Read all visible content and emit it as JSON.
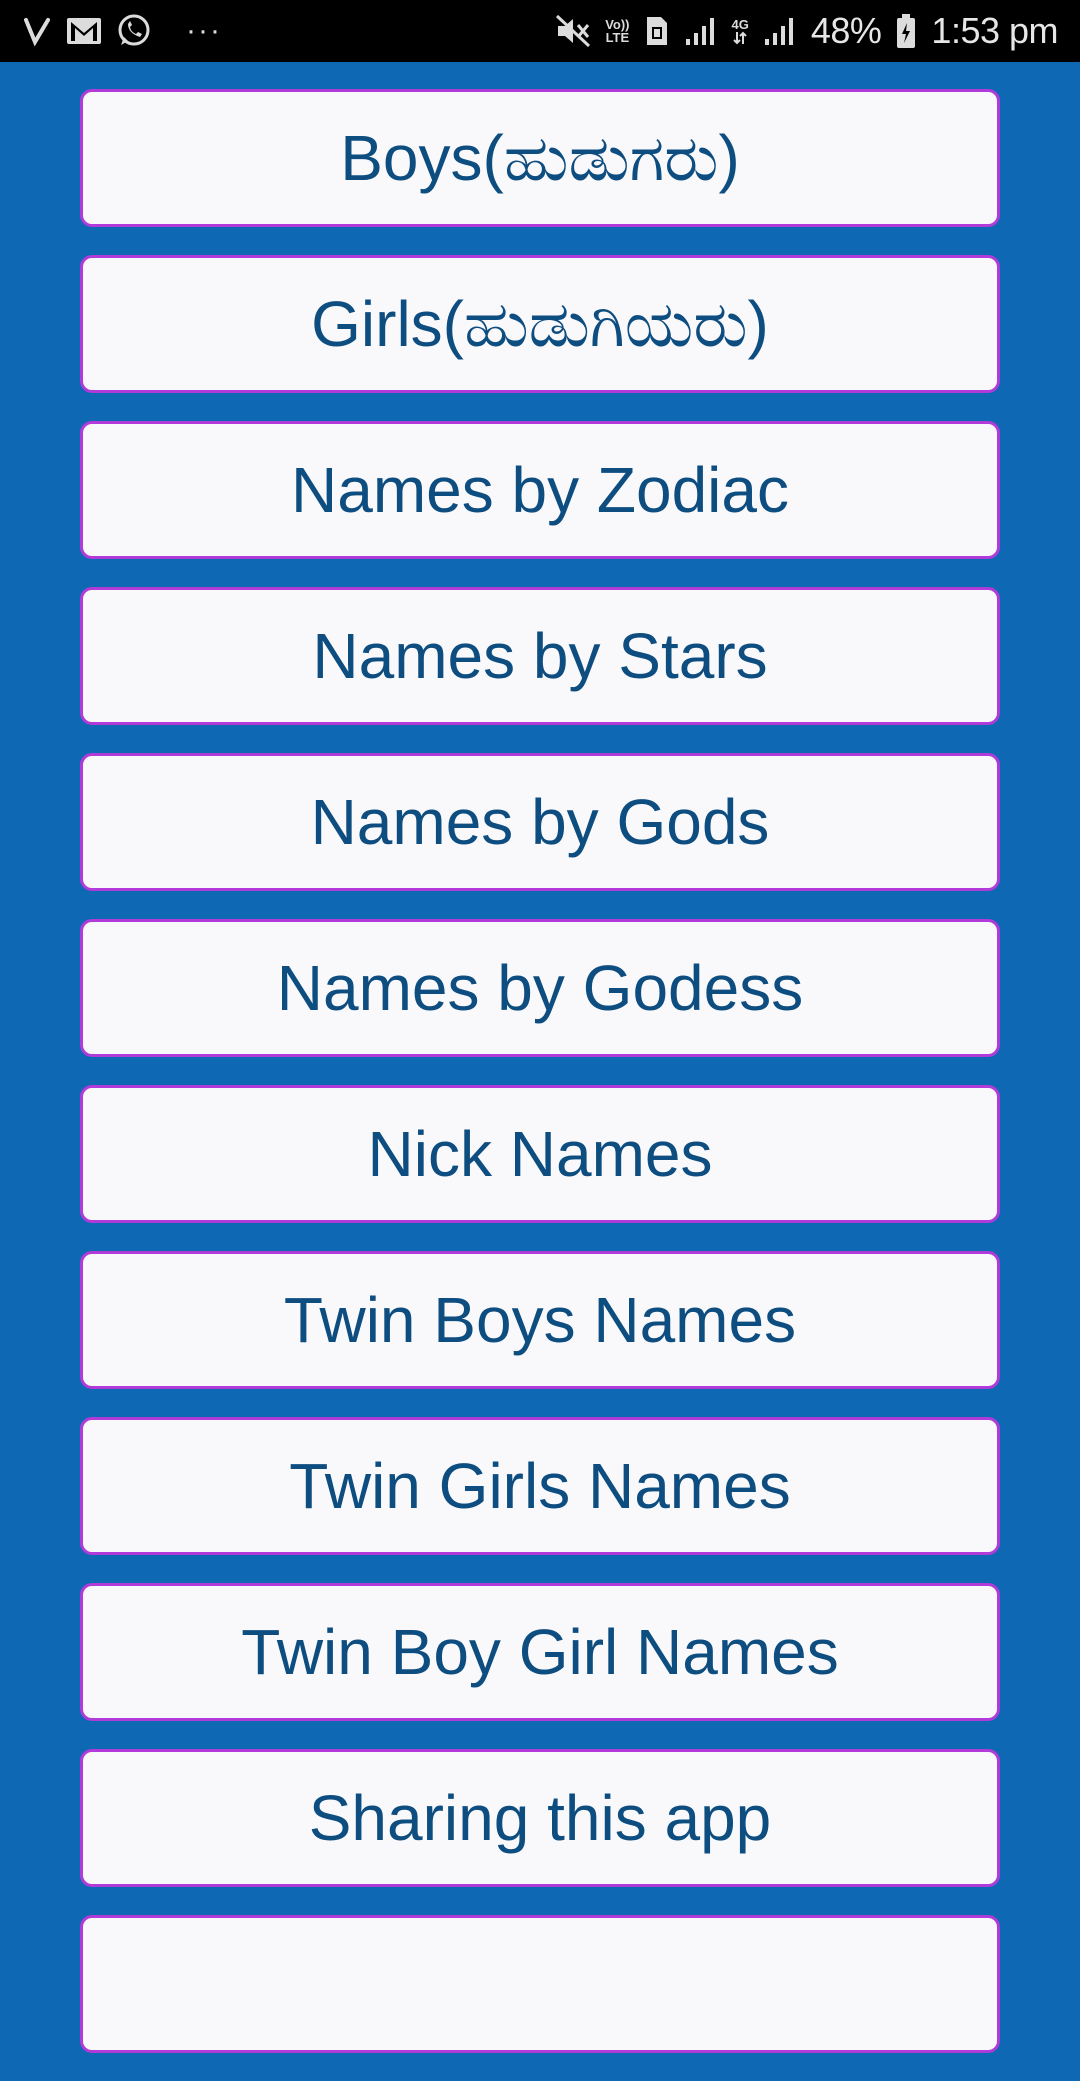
{
  "status_bar": {
    "battery_percent": "48%",
    "time": "1:53 pm",
    "volte_label_top": "Vo))",
    "volte_label_bottom": "LTE",
    "network_label": "4G",
    "left_icons": [
      "signal-check-icon",
      "gmail-icon",
      "whatsapp-icon",
      "more-dots-icon"
    ],
    "right_icons": [
      "mute-icon",
      "volte-icon",
      "sim-icon",
      "signal-bars-icon",
      "4g-icon",
      "signal-bars-icon",
      "battery-icon"
    ],
    "dots": "···"
  },
  "menu": {
    "items": [
      {
        "label": "Boys(ಹುಡುಗರು)"
      },
      {
        "label": "Girls(ಹುಡುಗಿಯರು)"
      },
      {
        "label": "Names by Zodiac"
      },
      {
        "label": "Names by Stars"
      },
      {
        "label": "Names by Gods"
      },
      {
        "label": "Names by Godess"
      },
      {
        "label": "Nick Names"
      },
      {
        "label": "Twin Boys Names"
      },
      {
        "label": "Twin Girls Names"
      },
      {
        "label": "Twin Boy Girl Names"
      },
      {
        "label": "Sharing this app"
      }
    ]
  },
  "colors": {
    "background": "#0f68b4",
    "button_fill": "#f9f9fc",
    "button_border": "#b03bd8",
    "button_text": "#0e4d80",
    "status_bar": "#000000"
  }
}
